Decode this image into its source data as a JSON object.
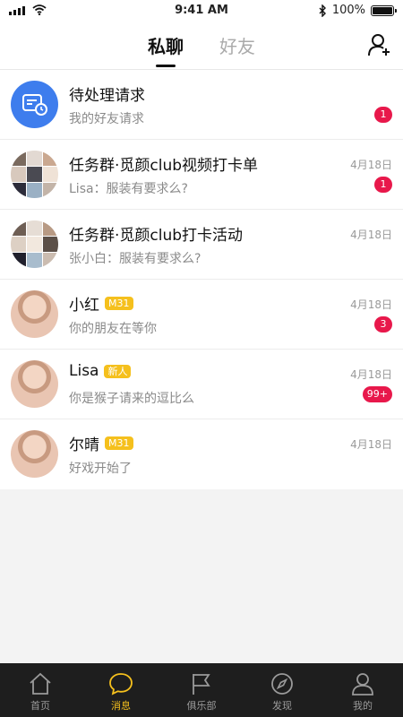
{
  "status_bar": {
    "time": "9:41 AM",
    "battery": "100%",
    "battery_level": 1.0
  },
  "header": {
    "tabs": [
      {
        "label": "私聊",
        "active": true
      },
      {
        "label": "好友",
        "active": false
      }
    ]
  },
  "conversations": [
    {
      "title": "待处理请求",
      "subtitle": "我的好友请求",
      "date": "",
      "badge": "1",
      "tag": "",
      "avatar": "request-icon"
    },
    {
      "title": "任务群·觅颜club视频打卡单",
      "subtitle": "Lisa：服装有要求么?",
      "date": "4月18日",
      "badge": "1",
      "tag": "",
      "avatar": "group"
    },
    {
      "title": "任务群·觅颜club打卡活动",
      "subtitle": "张小白：服装有要求么?",
      "date": "4月18日",
      "badge": "",
      "tag": "",
      "avatar": "group"
    },
    {
      "title": "小红",
      "subtitle": "你的朋友在等你",
      "date": "4月18日",
      "badge": "3",
      "tag": "M31",
      "avatar": "person"
    },
    {
      "title": "Lisa",
      "subtitle": "你是猴子请来的逗比么",
      "date": "4月18日",
      "badge": "99+",
      "tag": "新人",
      "avatar": "person"
    },
    {
      "title": "尔晴",
      "subtitle": "好戏开始了",
      "date": "4月18日",
      "badge": "",
      "tag": "M31",
      "avatar": "person"
    }
  ],
  "tabbar": {
    "items": [
      {
        "label": "首页",
        "icon": "home-icon",
        "active": false
      },
      {
        "label": "消息",
        "icon": "chat-bubble-icon",
        "active": true
      },
      {
        "label": "俱乐部",
        "icon": "flag-icon",
        "active": false
      },
      {
        "label": "发现",
        "icon": "compass-icon",
        "active": false
      },
      {
        "label": "我的",
        "icon": "person-icon",
        "active": false
      }
    ]
  },
  "colors": {
    "accent": "#f5c01d",
    "badge": "#e8184b",
    "request_avatar": "#3e7ded",
    "tabbar_bg": "#1e1e1e"
  }
}
